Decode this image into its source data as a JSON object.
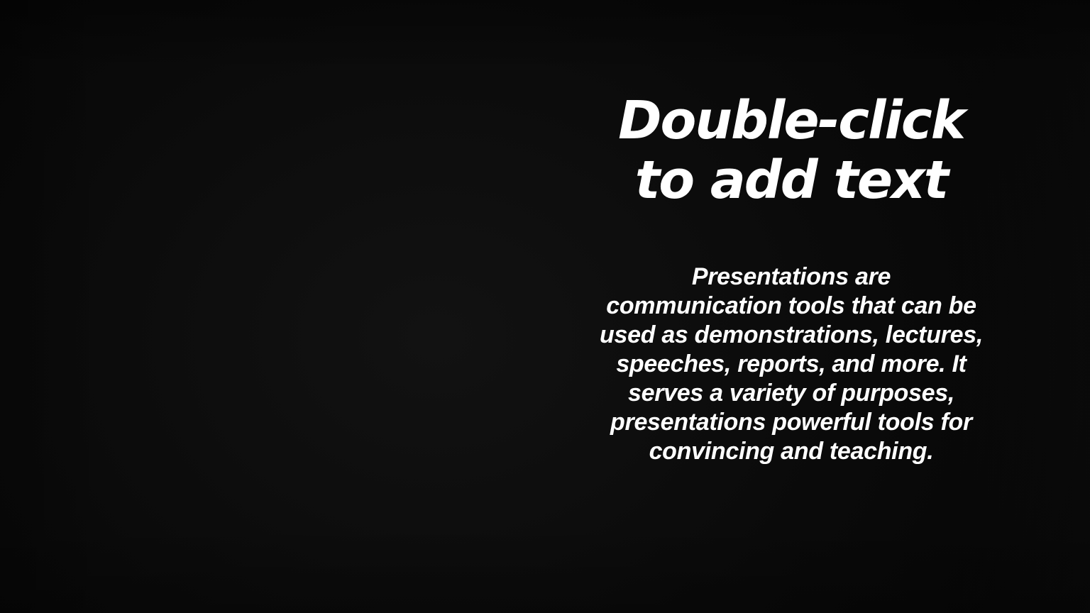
{
  "slide": {
    "title_line1": "Double-click",
    "title_line2": "to add text",
    "body_lines": [
      "Presentations are",
      "communication tools that can be",
      "used as demonstrations, lectures,",
      "speeches, reports, and more. It",
      "serves a variety of purposes,",
      "presentations powerful tools for",
      "convincing and teaching."
    ]
  },
  "colors": {
    "background": "#0b0b0b",
    "text": "#ffffff"
  }
}
